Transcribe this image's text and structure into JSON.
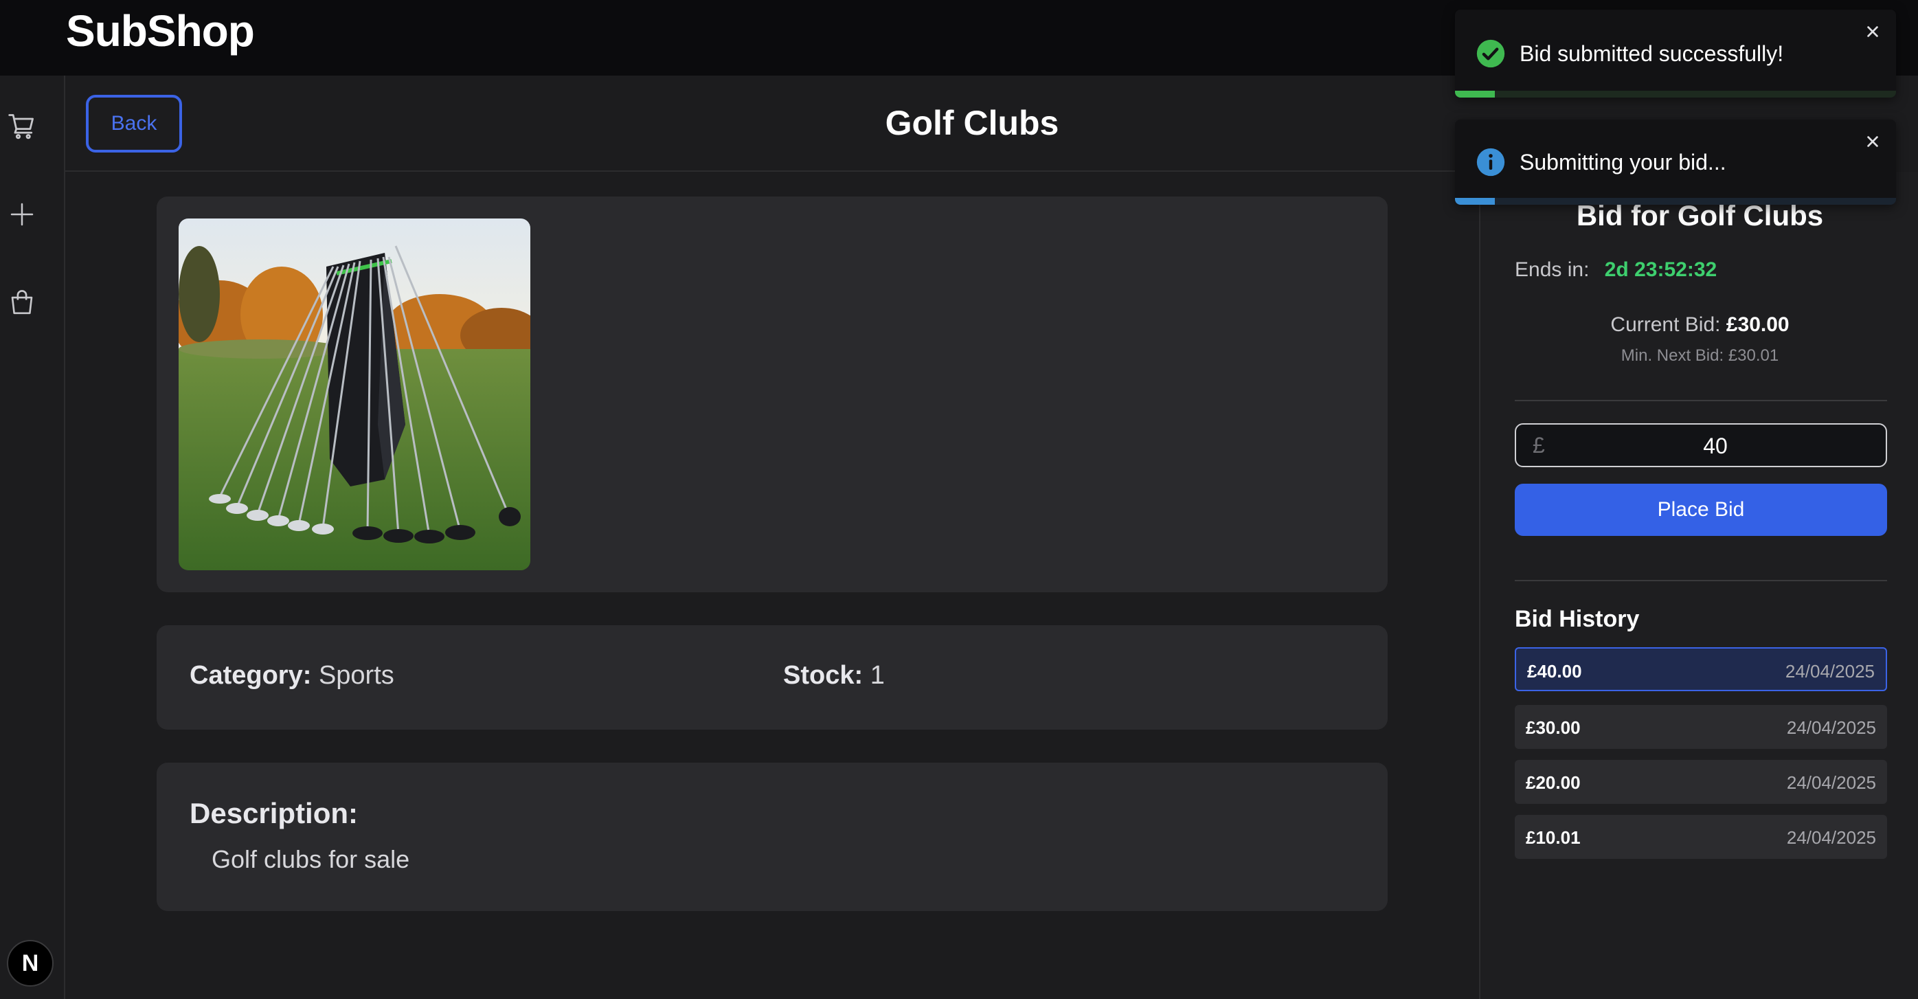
{
  "app": {
    "brand": "SubShop"
  },
  "sidebar": {
    "items": [
      {
        "icon": "cart-icon"
      },
      {
        "icon": "plus-icon"
      },
      {
        "icon": "shopping-bag-icon"
      }
    ],
    "badge": "N"
  },
  "header": {
    "back_label": "Back",
    "title": "Golf Clubs"
  },
  "product": {
    "image_alt": "golf-clubs-photo",
    "category_label": "Category:",
    "category_value": "Sports",
    "stock_label": "Stock:",
    "stock_value": "1",
    "description_label": "Description:",
    "description_text": "Golf clubs for sale"
  },
  "bid_panel": {
    "title": "Bid for Golf Clubs",
    "ends_label": "Ends in:",
    "ends_value": "2d 23:52:32",
    "current_label": "Current Bid:",
    "current_value": "£30.00",
    "min_next": "Min. Next Bid: £30.01",
    "currency_symbol": "£",
    "input_value": "40",
    "place_label": "Place Bid",
    "history_title": "Bid History",
    "history": [
      {
        "amount": "£40.00",
        "date": "24/04/2025",
        "active": true
      },
      {
        "amount": "£30.00",
        "date": "24/04/2025",
        "active": false
      },
      {
        "amount": "£20.00",
        "date": "24/04/2025",
        "active": false
      },
      {
        "amount": "£10.01",
        "date": "24/04/2025",
        "active": false
      }
    ]
  },
  "toasts": [
    {
      "type": "success",
      "icon": "check-circle-icon",
      "message": "Bid submitted successfully!",
      "progress": 0.09,
      "color": "#3fb950"
    },
    {
      "type": "info",
      "icon": "info-circle-icon",
      "message": "Submitting your bid...",
      "progress": 0.09,
      "color": "#3a8fd6"
    }
  ],
  "colors": {
    "accent": "#3461e6",
    "timer": "#3ecf6e",
    "background": "#1c1c1e",
    "card": "#2a2a2d"
  }
}
